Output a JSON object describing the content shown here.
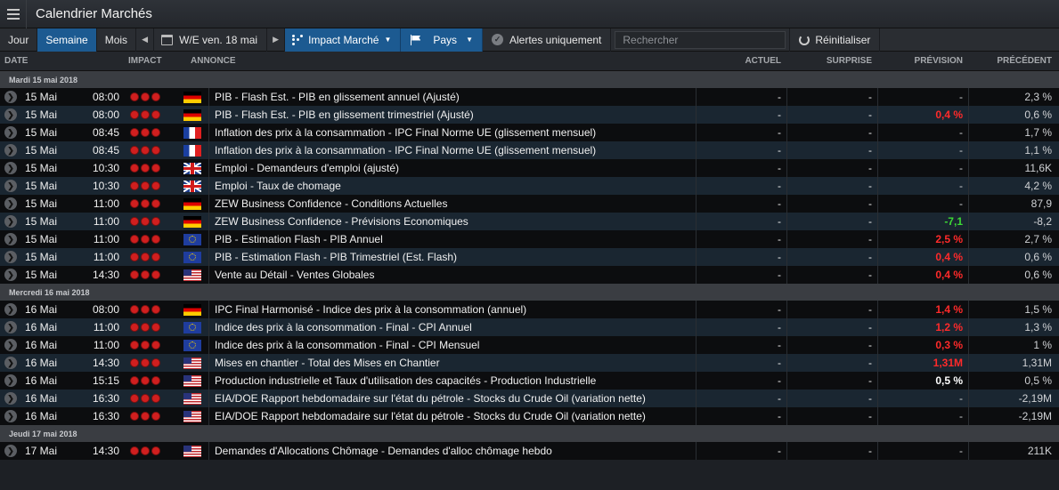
{
  "app": {
    "title": "Calendrier Marchés"
  },
  "toolbar": {
    "periods": [
      "Jour",
      "Semaine",
      "Mois"
    ],
    "active_period": "Semaine",
    "date_label": "W/E ven. 18 mai",
    "impact_label": "Impact Marché",
    "country_label": "Pays",
    "alerts_label": "Alertes uniquement",
    "search_placeholder": "Rechercher",
    "reset_label": "Réinitialiser"
  },
  "columns": {
    "date": "DATE",
    "impact": "IMPACT",
    "annonce": "ANNONCE",
    "actuel": "ACTUEL",
    "surprise": "SURPRISE",
    "prevision": "PRÉVISION",
    "precedent": "PRÉCÉDENT"
  },
  "colors": {
    "accent": "#1c5a91",
    "negative": "#ff2a2a",
    "positive": "#3ddc35",
    "impact_dot": "#d01f1f"
  },
  "groups": [
    {
      "heading": "Mardi 15 mai 2018",
      "rows": [
        {
          "day": "15 Mai",
          "time": "08:00",
          "flag": "germany",
          "title": "PIB - Flash Est. - PIB en glissement annuel (Ajusté)",
          "actuel": "-",
          "surprise": "-",
          "prevision": "-",
          "prevision_style": "muted",
          "precedent": "2,3 %"
        },
        {
          "day": "15 Mai",
          "time": "08:00",
          "flag": "germany",
          "title": "PIB - Flash Est. - PIB en glissement trimestriel (Ajusté)",
          "actuel": "-",
          "surprise": "-",
          "prevision": "0,4 %",
          "prevision_style": "red",
          "precedent": "0,6 %"
        },
        {
          "day": "15 Mai",
          "time": "08:45",
          "flag": "france",
          "title": "Inflation des prix à la consammation - IPC Final Norme UE (glissement mensuel)",
          "actuel": "-",
          "surprise": "-",
          "prevision": "-",
          "prevision_style": "muted",
          "precedent": "1,7 %"
        },
        {
          "day": "15 Mai",
          "time": "08:45",
          "flag": "france",
          "title": "Inflation des prix à la consammation - IPC Final Norme UE (glissement mensuel)",
          "actuel": "-",
          "surprise": "-",
          "prevision": "-",
          "prevision_style": "muted",
          "precedent": "1,1 %"
        },
        {
          "day": "15 Mai",
          "time": "10:30",
          "flag": "uk",
          "title": "Emploi - Demandeurs d'emploi (ajusté)",
          "actuel": "-",
          "surprise": "-",
          "prevision": "-",
          "prevision_style": "muted",
          "precedent": "11,6K"
        },
        {
          "day": "15 Mai",
          "time": "10:30",
          "flag": "uk",
          "title": "Emploi - Taux de chomage",
          "actuel": "-",
          "surprise": "-",
          "prevision": "-",
          "prevision_style": "muted",
          "precedent": "4,2 %"
        },
        {
          "day": "15 Mai",
          "time": "11:00",
          "flag": "germany",
          "title": "ZEW Business Confidence - Conditions Actuelles",
          "actuel": "-",
          "surprise": "-",
          "prevision": "-",
          "prevision_style": "muted",
          "precedent": "87,9"
        },
        {
          "day": "15 Mai",
          "time": "11:00",
          "flag": "germany",
          "title": "ZEW Business Confidence - Prévisions Economiques",
          "actuel": "-",
          "surprise": "-",
          "prevision": "-7,1",
          "prevision_style": "green",
          "precedent": "-8,2"
        },
        {
          "day": "15 Mai",
          "time": "11:00",
          "flag": "eu",
          "title": "PIB - Estimation Flash - PIB Annuel",
          "actuel": "-",
          "surprise": "-",
          "prevision": "2,5 %",
          "prevision_style": "red",
          "precedent": "2,7 %"
        },
        {
          "day": "15 Mai",
          "time": "11:00",
          "flag": "eu",
          "title": "PIB - Estimation Flash - PIB Trimestriel (Est. Flash)",
          "actuel": "-",
          "surprise": "-",
          "prevision": "0,4 %",
          "prevision_style": "red",
          "precedent": "0,6 %"
        },
        {
          "day": "15 Mai",
          "time": "14:30",
          "flag": "us",
          "title": "Vente au Détail - Ventes Globales",
          "actuel": "-",
          "surprise": "-",
          "prevision": "0,4 %",
          "prevision_style": "red",
          "precedent": "0,6 %"
        }
      ]
    },
    {
      "heading": "Mercredi 16 mai 2018",
      "rows": [
        {
          "day": "16 Mai",
          "time": "08:00",
          "flag": "germany",
          "title": "IPC Final Harmonisé - Indice des prix à la consommation (annuel)",
          "actuel": "-",
          "surprise": "-",
          "prevision": "1,4 %",
          "prevision_style": "red",
          "precedent": "1,5 %"
        },
        {
          "day": "16 Mai",
          "time": "11:00",
          "flag": "eu",
          "title": "Indice des prix à la consommation - Final - CPI Annuel",
          "actuel": "-",
          "surprise": "-",
          "prevision": "1,2 %",
          "prevision_style": "red",
          "precedent": "1,3 %"
        },
        {
          "day": "16 Mai",
          "time": "11:00",
          "flag": "eu",
          "title": "Indice des prix à la consommation - Final - CPI Mensuel",
          "actuel": "-",
          "surprise": "-",
          "prevision": "0,3 %",
          "prevision_style": "red",
          "precedent": "1 %"
        },
        {
          "day": "16 Mai",
          "time": "14:30",
          "flag": "us",
          "title": "Mises en chantier - Total des Mises en Chantier",
          "actuel": "-",
          "surprise": "-",
          "prevision": "1,31M",
          "prevision_style": "red",
          "precedent": "1,31M"
        },
        {
          "day": "16 Mai",
          "time": "15:15",
          "flag": "us",
          "title": "Production industrielle et Taux d'utilisation des capacités - Production Industrielle",
          "actuel": "-",
          "surprise": "-",
          "prevision": "0,5 %",
          "prevision_style": "white",
          "precedent": "0,5 %"
        },
        {
          "day": "16 Mai",
          "time": "16:30",
          "flag": "us",
          "title": "EIA/DOE Rapport hebdomadaire sur l'état du pétrole - Stocks du Crude Oil (variation nette)",
          "actuel": "-",
          "surprise": "-",
          "prevision": "-",
          "prevision_style": "muted",
          "precedent": "-2,19M"
        },
        {
          "day": "16 Mai",
          "time": "16:30",
          "flag": "us",
          "title": "EIA/DOE Rapport hebdomadaire sur l'état du pétrole - Stocks du Crude Oil (variation nette)",
          "actuel": "-",
          "surprise": "-",
          "prevision": "-",
          "prevision_style": "muted",
          "precedent": "-2,19M"
        }
      ]
    },
    {
      "heading": "Jeudi 17 mai 2018",
      "rows": [
        {
          "day": "17 Mai",
          "time": "14:30",
          "flag": "us",
          "title": "Demandes d'Allocations Chômage - Demandes d'alloc chômage hebdo",
          "actuel": "-",
          "surprise": "-",
          "prevision": "-",
          "prevision_style": "muted",
          "precedent": "211K"
        }
      ]
    }
  ]
}
